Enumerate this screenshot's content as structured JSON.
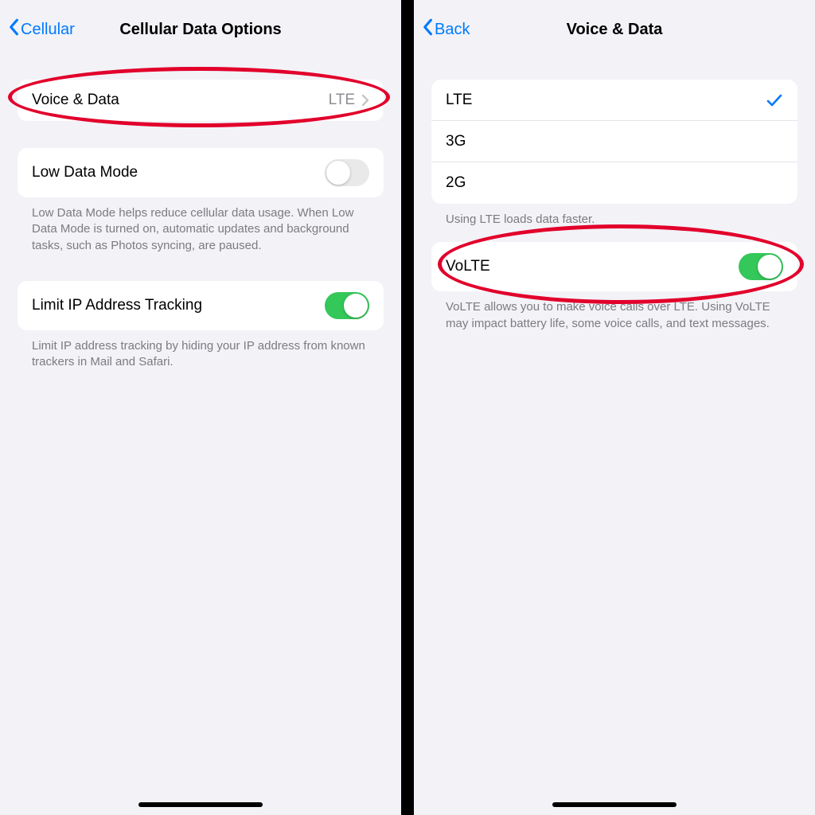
{
  "left": {
    "nav": {
      "back": "Cellular",
      "title": "Cellular Data Options"
    },
    "voiceData": {
      "label": "Voice & Data",
      "value": "LTE"
    },
    "lowData": {
      "label": "Low Data Mode",
      "on": false,
      "note": "Low Data Mode helps reduce cellular data usage. When Low Data Mode is turned on, automatic updates and background tasks, such as Photos syncing, are paused."
    },
    "limitIP": {
      "label": "Limit IP Address Tracking",
      "on": true,
      "note": "Limit IP address tracking by hiding your IP address from known trackers in Mail and Safari."
    }
  },
  "right": {
    "nav": {
      "back": "Back",
      "title": "Voice & Data"
    },
    "options": [
      {
        "label": "LTE",
        "selected": true
      },
      {
        "label": "3G",
        "selected": false
      },
      {
        "label": "2G",
        "selected": false
      }
    ],
    "optionsNote": "Using LTE loads data faster.",
    "volte": {
      "label": "VoLTE",
      "on": true,
      "note": "VoLTE allows you to make voice calls over LTE. Using VoLTE may impact battery life, some voice calls, and text messages."
    }
  },
  "colors": {
    "accent": "#007aff",
    "toggleOn": "#34c759",
    "annotation": "#e2002b"
  }
}
